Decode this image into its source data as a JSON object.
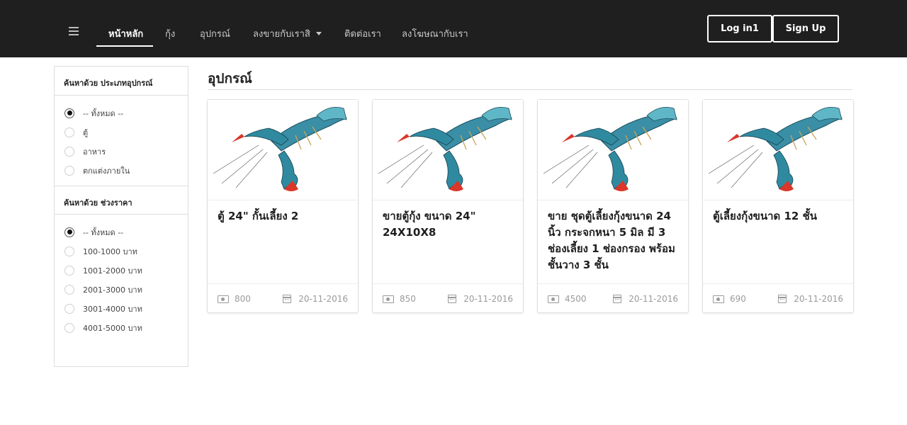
{
  "nav": {
    "menu_icon": "hamburger-icon",
    "items": [
      {
        "label": "หน้าหลัก",
        "active": true
      },
      {
        "label": "กุ้ง"
      },
      {
        "label": "อุปกรณ์"
      },
      {
        "label": "ลงขายกับเราสิ",
        "has_dropdown": true
      },
      {
        "label": "ติดต่อเรา"
      },
      {
        "label": "ลงโฆษณากับเรา"
      }
    ],
    "login_label": "Log in1",
    "signup_label": "Sign Up"
  },
  "sidebar": {
    "type_filter": {
      "heading": "ค้นหาด้วย ประเภทอุปกรณ์",
      "options": [
        "-- ทั้งหมด --",
        "ตู้",
        "อาหาร",
        "ตกแต่งภายใน"
      ],
      "selected": "-- ทั้งหมด --"
    },
    "price_filter": {
      "heading": "ค้นหาด้วย ช่วงราคา",
      "options": [
        "-- ทั้งหมด --",
        "100-1000 บาท",
        "1001-2000 บาท",
        "2001-3000 บาท",
        "3001-4000 บาท",
        "4001-5000 บาท"
      ],
      "selected": "-- ทั้งหมด --"
    }
  },
  "main": {
    "title": "อุปกรณ์",
    "products": [
      {
        "title": "ตู้ 24\" กั้นเลี้ยง 2",
        "price": "800",
        "date": "20-11-2016",
        "image": "crayfish-image"
      },
      {
        "title": "ขายตู้กุ้ง ขนาด 24\" 24X10X8",
        "price": "850",
        "date": "20-11-2016",
        "image": "crayfish-image"
      },
      {
        "title": "ขาย ชุดตู้เลี้ยงกุ้งขนาด 24 นิ้ว กระจกหนา 5 มิล มี 3 ช่องเลี้ยง 1 ช่องกรอง พร้อมชั้นวาง 3 ชั้น",
        "price": "4500",
        "date": "20-11-2016",
        "image": "crayfish-image"
      },
      {
        "title": "ตู้เลี้ยงกุ้งขนาด 12 ชั้น",
        "price": "690",
        "date": "20-11-2016",
        "image": "crayfish-image"
      }
    ]
  },
  "colors": {
    "navbar_bg": "#1f1f1f",
    "crayfish_body": "#2f8aa0",
    "crayfish_claw_tip": "#d9372a"
  }
}
